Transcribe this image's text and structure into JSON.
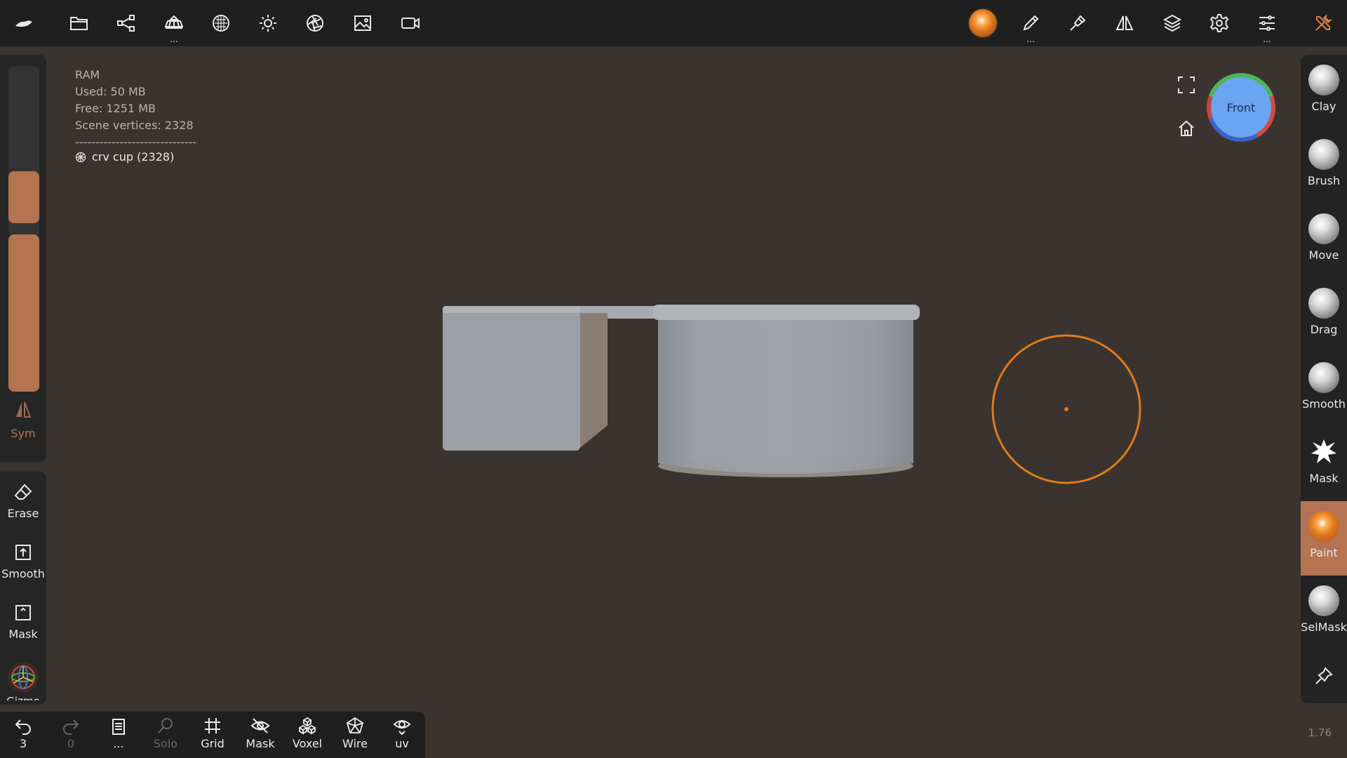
{
  "topbar": {
    "left_icons": [
      "app-logo-icon",
      "folder-icon",
      "share-icon",
      "scene-icon",
      "material-icon",
      "light-icon",
      "camera-lens-icon",
      "image-icon",
      "video-icon"
    ],
    "right_icons": [
      "paint-material-icon",
      "pencil-icon",
      "brush-icon",
      "symmetry-icon",
      "layers-icon",
      "settings-icon",
      "sliders-icon",
      "tools-icon"
    ],
    "dots": "..."
  },
  "left_panel": {
    "sym_label": "Sym",
    "tools": [
      {
        "label": "Erase"
      },
      {
        "label": "Smooth"
      },
      {
        "label": "Mask"
      },
      {
        "label": "Gizmo"
      }
    ]
  },
  "info": {
    "ram": "RAM",
    "used": "Used: 50 MB",
    "free": "Free: 1251 MB",
    "vertices": "Scene vertices: 2328",
    "separator": "------------------------------",
    "object": "crv cup (2328)"
  },
  "gizmo": {
    "face_label": "Front"
  },
  "right_panel": {
    "tools": [
      {
        "label": "Clay"
      },
      {
        "label": "Brush"
      },
      {
        "label": "Move"
      },
      {
        "label": "Drag"
      },
      {
        "label": "Smooth"
      },
      {
        "label": "Mask"
      },
      {
        "label": "Paint"
      },
      {
        "label": "SelMask"
      }
    ],
    "active_tool": "Paint"
  },
  "bottombar": {
    "undo_count": "3",
    "redo_count": "0",
    "more_label": "...",
    "items": [
      {
        "label": "Solo"
      },
      {
        "label": "Grid"
      },
      {
        "label": "Mask"
      },
      {
        "label": "Voxel"
      },
      {
        "label": "Wire"
      },
      {
        "label": "uv"
      }
    ]
  },
  "version": "1.76",
  "colors": {
    "accent": "#b47451",
    "cursor_ring": "#e07b1a",
    "viewport_bg": "#3a332f"
  }
}
